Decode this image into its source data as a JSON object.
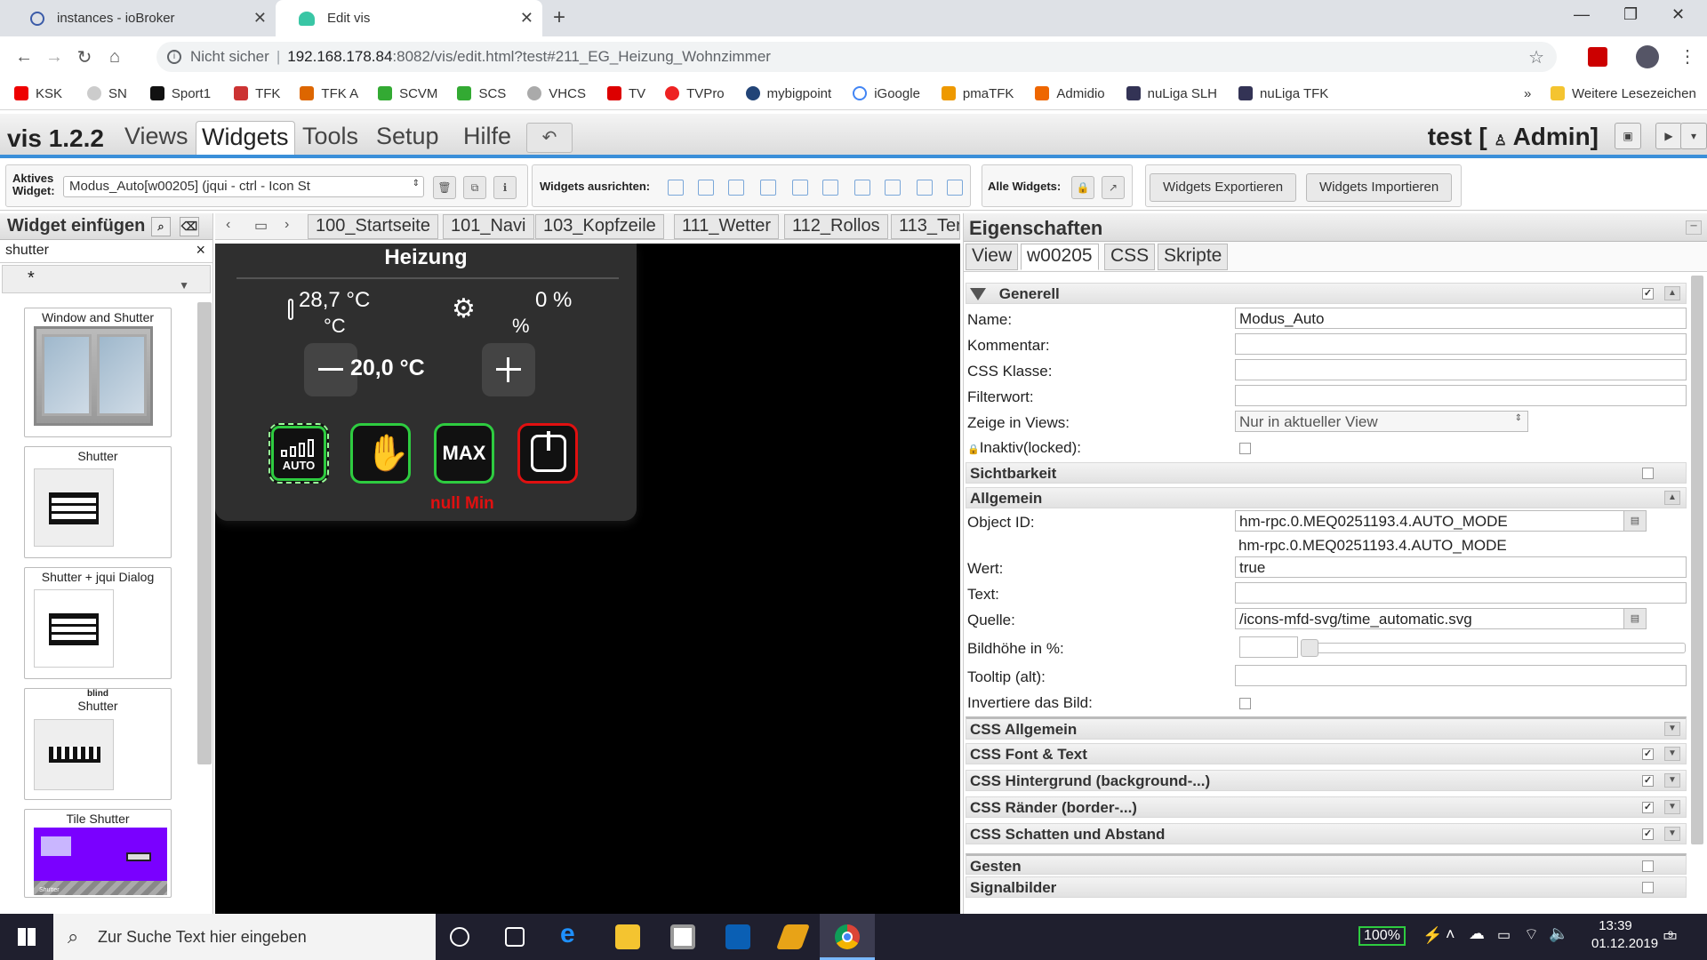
{
  "browser": {
    "tabs": [
      {
        "title": "instances - ioBroker"
      },
      {
        "title": "Edit vis"
      }
    ],
    "address": {
      "security": "Nicht sicher",
      "host": "192.168.178.84",
      "path": ":8082/vis/edit.html?test#211_EG_Heizung_Wohnzimmer"
    },
    "bookmarks": [
      "KSK",
      "SN",
      "Sport1",
      "TFK",
      "TFK A",
      "SCVM",
      "SCS",
      "VHCS",
      "TV",
      "TVPro",
      "mybigpoint",
      "iGoogle",
      "pmaTFK",
      "Admidio",
      "nuLiga SLH",
      "nuLiga TFK"
    ],
    "bookmarks_more": "»",
    "other_bookmarks": "Weitere Lesezeichen"
  },
  "vis": {
    "brand": "vis 1.2.2",
    "menu": [
      "Views",
      "Widgets",
      "Tools",
      "Setup",
      "Hilfe"
    ],
    "user": "test [",
    "user_role": "Admin]"
  },
  "toolbar": {
    "active_label_1": "Aktives",
    "active_label_2": "Widget:",
    "active_widget": "Modus_Auto[w00205] (jqui - ctrl - Icon St",
    "align_label": "Widgets ausrichten:",
    "all_label": "Alle Widgets:",
    "export": "Widgets Exportieren",
    "import": "Widgets Importieren"
  },
  "left": {
    "title": "Widget einfügen",
    "search": "shutter",
    "search_clear": "×",
    "filter": "*",
    "widgets": [
      {
        "title": "Window and Shutter"
      },
      {
        "title": "Shutter"
      },
      {
        "title": "Shutter + jqui Dialog"
      },
      {
        "title": "Shutter",
        "subtitle": "blind"
      },
      {
        "title": "Tile Shutter",
        "sublabel": "Shutter"
      }
    ]
  },
  "views": {
    "tabs": [
      "100_Startseite",
      "101_Navi",
      "103_Kopfzeile",
      "111_Wetter",
      "112_Rollos",
      "113_Ter"
    ]
  },
  "heating": {
    "title": "Heizung",
    "temp": "28,7 °C",
    "temp_unit": "°C",
    "valve": "0 %",
    "valve_unit": "%",
    "setpoint": "20,0 °C",
    "mode_auto": "AUTO",
    "mode_max": "MAX",
    "status": "null Min"
  },
  "props": {
    "title": "Eigenschaften",
    "tabs": [
      "View",
      "w00205",
      "CSS",
      "Skripte"
    ],
    "sections": {
      "generell": "Generell",
      "sichtbarkeit": "Sichtbarkeit",
      "allgemein": "Allgemein",
      "css_allgemein": "CSS Allgemein",
      "css_font": "CSS Font & Text",
      "css_bg": "CSS Hintergrund (background-...)",
      "css_border": "CSS Ränder (border-...)",
      "css_shadow": "CSS Schatten und Abstand",
      "gesten": "Gesten",
      "signalbilder": "Signalbilder"
    },
    "labels": {
      "name": "Name:",
      "kommentar": "Kommentar:",
      "css_klasse": "CSS Klasse:",
      "filterwort": "Filterwort:",
      "zeige": "Zeige in Views:",
      "inaktiv": "Inaktiv(locked):",
      "oid": "Object ID:",
      "wert": "Wert:",
      "text": "Text:",
      "quelle": "Quelle:",
      "bildhoehe": "Bildhöhe in %:",
      "tooltip": "Tooltip (alt):",
      "invert": "Invertiere das Bild:"
    },
    "values": {
      "name": "Modus_Auto",
      "zeige": "Nur in aktueller View",
      "oid": "hm-rpc.0.MEQ0251193.4.AUTO_MODE",
      "oid_hint": "hm-rpc.0.MEQ0251193.4.AUTO_MODE",
      "wert": "true",
      "quelle": "/icons-mfd-svg/time_automatic.svg"
    }
  },
  "taskbar": {
    "search": "Zur Suche Text hier eingeben",
    "battery": "100%",
    "time": "13:39",
    "date": "01.12.2019",
    "notifications": "9"
  }
}
